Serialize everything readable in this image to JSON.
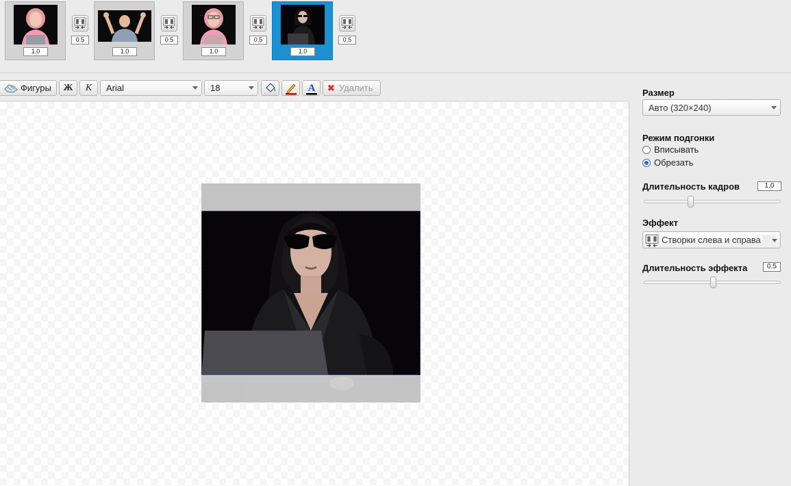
{
  "timeline": {
    "frames": [
      {
        "name": "frame-1",
        "duration": "1.0",
        "selected": false
      },
      {
        "name": "frame-2",
        "duration": "1.0",
        "selected": false
      },
      {
        "name": "frame-3",
        "duration": "1.0",
        "selected": false
      },
      {
        "name": "frame-4",
        "duration": "1.0",
        "selected": true
      }
    ],
    "transitions": [
      {
        "icon": "doors-transition-icon",
        "duration": "0.5"
      },
      {
        "icon": "doors-transition-icon",
        "duration": "0.5"
      },
      {
        "icon": "doors-transition-icon",
        "duration": "0.5"
      },
      {
        "icon": "doors-transition-icon",
        "duration": "0.5"
      }
    ]
  },
  "toolbar": {
    "shapes_label": "Фигуры",
    "bold_label": "Ж",
    "italic_label": "К",
    "font_family": "Arial",
    "font_size": "18",
    "delete_label": "Удалить",
    "icons": [
      "shapes-icon",
      "fill-bucket-icon",
      "pencil-color-icon",
      "text-color-icon",
      "delete-x-icon"
    ],
    "colors": {
      "pencil_underline": "#d40000",
      "text_color_underline": "#1a4f9c",
      "delete_x": "#d63a3a"
    }
  },
  "settings": {
    "size_label": "Размер",
    "size_value": "Авто (320×240)",
    "fit_mode_label": "Режим подгонки",
    "fit_options": [
      {
        "label": "Вписывать",
        "checked": false
      },
      {
        "label": "Обрезать",
        "checked": true
      }
    ],
    "frame_duration_label": "Длительность кадров",
    "frame_duration_value": "1.0",
    "frame_duration_slider": 0.33,
    "effect_label": "Эффект",
    "effect_value": "Створки слева и справа (",
    "effect_duration_label": "Длительность эффекта",
    "effect_duration_value": "0.5",
    "effect_duration_slider": 0.5
  },
  "colors": {
    "accent": "#1e8fd0",
    "panel_bg": "#ebebeb",
    "crop_border": "#5a5ad0"
  }
}
